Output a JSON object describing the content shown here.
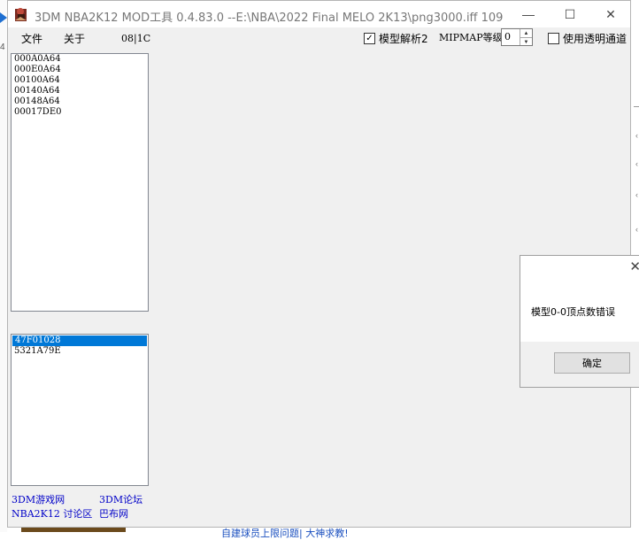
{
  "window": {
    "title": "3DM NBA2K12 MOD工具 0.4.83.0 --E:\\NBA\\2022 Final MELO 2K13\\png3000.iff  109",
    "minimize": "—",
    "maximize": "☐",
    "close": "✕"
  },
  "menu": {
    "file": "文件",
    "about": "关于"
  },
  "hexcode": "08|1C",
  "list_top": [
    "000A0A64",
    "000E0A64",
    "00100A64",
    "00140A64",
    "00148A64",
    "00017DE0"
  ],
  "list_bottom": [
    "47F01028",
    "5321A79E"
  ],
  "links": {
    "game_net": "3DM游戏网",
    "forum": "3DM论坛",
    "discussion": "NBA2K12 讨论区",
    "babu": "巴布网"
  },
  "options": {
    "model_parse_label": "模型解析2",
    "model_parse_checked": true,
    "mipmap_label": "MIPMAP等级",
    "mipmap_value": "0",
    "transparency_label": "使用透明通道",
    "transparency_checked": false
  },
  "dialog": {
    "message": "模型0-0顶点数错误",
    "ok_label": "确定",
    "close": "✕"
  },
  "background": {
    "bottom_text": "自建球员上限问题| 大神求教!",
    "left_char": "4"
  },
  "colors": {
    "selection": "#0078d7",
    "link": "#0000c8"
  }
}
